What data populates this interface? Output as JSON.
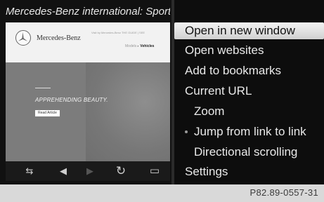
{
  "left": {
    "title": "Mercedes-Benz international: Sports",
    "site": {
      "brand": "Mercedes-Benz",
      "meta": "Visit by Mercedes-Benz   THE GUIDE | SEE",
      "nav_prefix": "Models ▸",
      "nav_active": "Vehicles"
    },
    "hero": {
      "headline": "APPREHENDING BEAUTY.",
      "button": "Read Article"
    },
    "toolbar": {
      "back": "⇆",
      "prev": "◀",
      "next": "▶",
      "reload": "↻",
      "keyboard": "▭"
    }
  },
  "menu": {
    "items": [
      {
        "label": "Open in new window",
        "selected": true
      },
      {
        "label": "Open websites"
      },
      {
        "label": "Add to bookmarks"
      },
      {
        "label": "Current URL"
      },
      {
        "label": "Zoom"
      },
      {
        "label": "Jump from link to link",
        "bullet": true
      },
      {
        "label": "Directional scrolling"
      },
      {
        "label": "Settings"
      }
    ]
  },
  "figure_code": "P82.89-0557-31"
}
